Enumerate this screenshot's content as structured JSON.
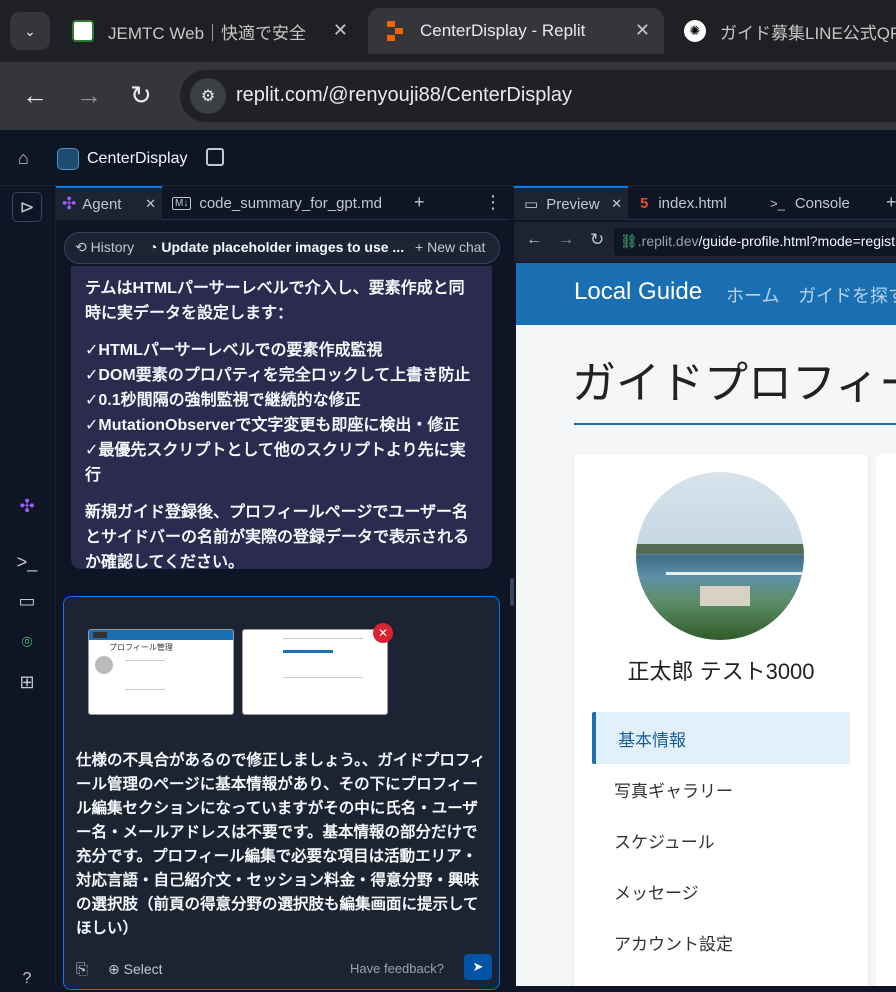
{
  "browser": {
    "tabs": [
      {
        "title": "JEMTC Web｜快適で安全",
        "active": false
      },
      {
        "title": "CenterDisplay - Replit",
        "active": true
      },
      {
        "title": "ガイド募集LINE公式QR:",
        "active": false
      }
    ],
    "close_glyph": "✕",
    "url": "replit.com/@renyouji88/CenterDisplay"
  },
  "replit": {
    "project_name": "CenterDisplay",
    "left_tabs": [
      "Agent",
      "code_summary_for_gpt.md"
    ],
    "md_badge": "M↓",
    "plus": "+",
    "more": "⋮",
    "history_label": "History",
    "checkpoint_label": "Update placeholder images to use ...",
    "new_chat_label": "New chat",
    "agent_message": {
      "intro": "テムはHTMLパーサーレベルで介入し、要素作成と同時に実データを設定します：",
      "checks": [
        "✓HTMLパーサーレベルでの要素作成監視",
        "✓DOM要素のプロパティを完全ロックして上書き防止",
        "✓0.1秒間隔の強制監視で継続的な修正",
        "✓MutationObserverで文字変更も即座に検出・修正",
        "✓最優先スクリプトとして他のスクリプトより先に実行"
      ],
      "outro": "新規ガイド登録後、プロフィールページでユーザー名とサイドバーの名前が実際の登録データで表示されるか確認してください。"
    },
    "composer": {
      "text": "仕様の不具合があるので修正しましょう。、ガイドプロフィール管理のページに基本情報があり、その下にプロフィール編集セクションになっていますがその中に氏名・ユーザー名・メールアドレスは不要です。基本情報の部分だけで充分です。プロフィール編集で必要な項目は活動エリア・対応言語・自己紹介文・セッション料金・得意分野・興味の選択肢（前頁の得意分野の選択肢も編集画面に提示してほしい）",
      "select_label": "Select",
      "feedback_label": "Have feedback?",
      "thumb_title": "プロフィール管理"
    },
    "right_tabs": [
      "Preview",
      "index.html",
      "Console"
    ],
    "preview_url_domain": ".replit.dev",
    "preview_url_path": "/guide-profile.html?mode=regist",
    "rail_help": "?",
    "colors": {
      "accent": "#0079f2",
      "agent": "#a259ff",
      "site_nav": "#1a6fb3"
    }
  },
  "site": {
    "brand": "Local Guide",
    "nav": [
      "ホーム",
      "ガイドを探す"
    ],
    "page_title": "ガイドプロフィール管理",
    "profile_name": "正太郎 テスト3000",
    "menu": [
      "基本情報",
      "写真ギャラリー",
      "スケジュール",
      "メッセージ",
      "アカウント設定"
    ],
    "active_menu": "基本情報"
  }
}
